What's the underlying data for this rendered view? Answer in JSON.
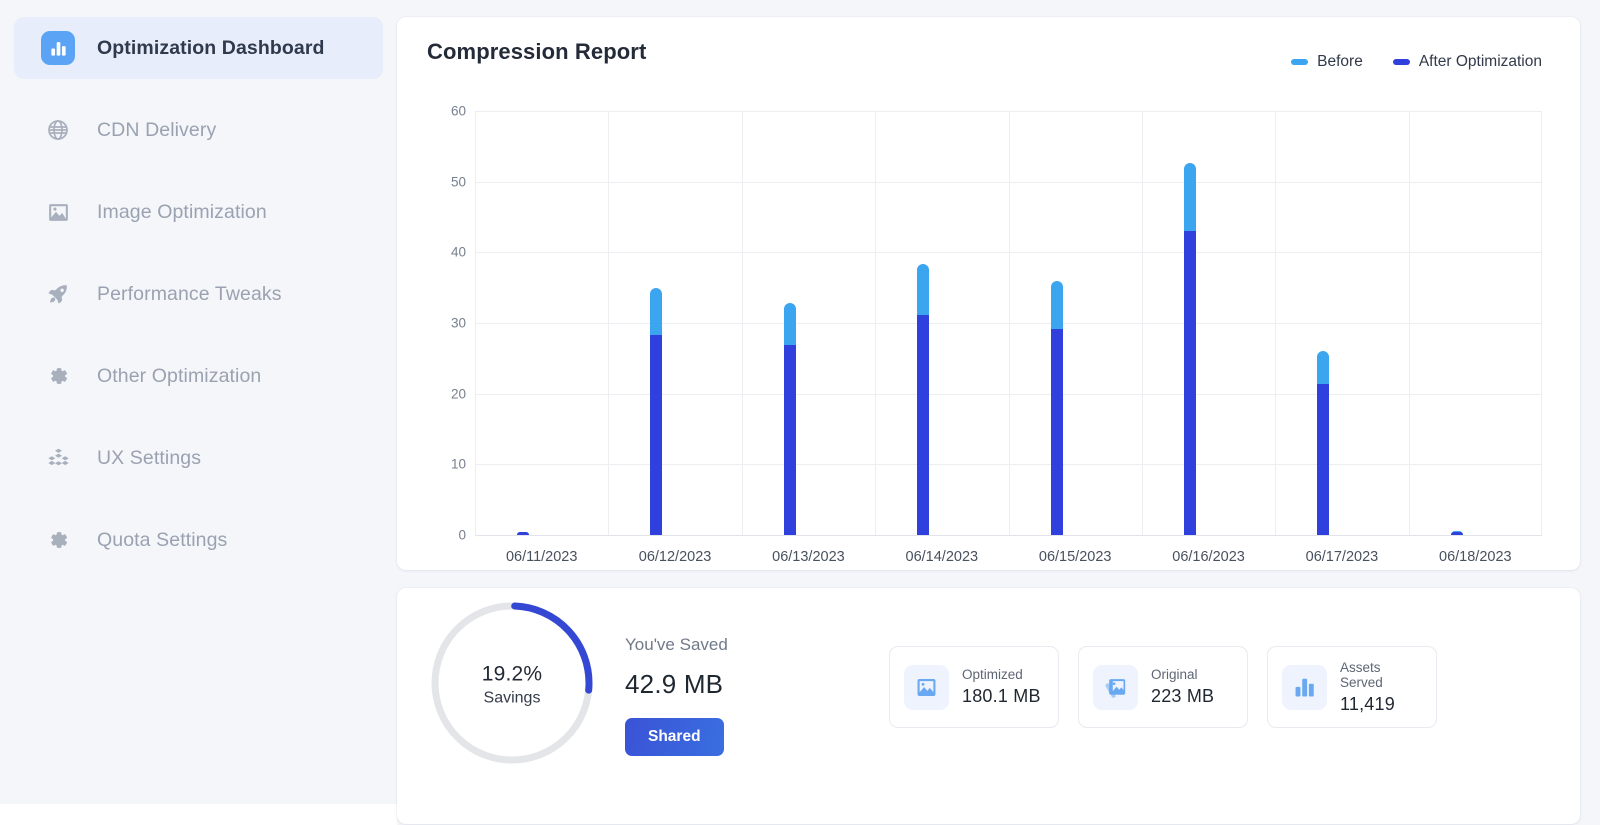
{
  "sidebar": {
    "items": [
      {
        "label": "Optimization Dashboard",
        "icon": "bar-chart-icon",
        "active": true
      },
      {
        "label": "CDN Delivery",
        "icon": "globe-icon",
        "active": false
      },
      {
        "label": "Image Optimization",
        "icon": "image-icon",
        "active": false
      },
      {
        "label": "Performance Tweaks",
        "icon": "rocket-icon",
        "active": false
      },
      {
        "label": "Other Optimization",
        "icon": "gear-icon",
        "active": false
      },
      {
        "label": "UX Settings",
        "icon": "cubes-icon",
        "active": false
      },
      {
        "label": "Quota Settings",
        "icon": "gear-icon",
        "active": false
      }
    ]
  },
  "chart_card": {
    "title": "Compression Report"
  },
  "chart_data": {
    "type": "bar",
    "title": "Compression Report",
    "stacked": true,
    "xlabel": "",
    "ylabel": "",
    "ylim": [
      0,
      60
    ],
    "yticks": [
      0,
      10,
      20,
      30,
      40,
      50,
      60
    ],
    "grid": true,
    "legend_position": "top-right",
    "categories": [
      "06/11/2023",
      "06/12/2023",
      "06/13/2023",
      "06/14/2023",
      "06/15/2023",
      "06/16/2023",
      "06/17/2023",
      "06/18/2023"
    ],
    "series": [
      {
        "name": "After Optimization",
        "color": "#3040dc",
        "values": [
          0.3,
          28.3,
          26.9,
          31.2,
          29.2,
          43.0,
          21.3,
          0.4
        ]
      },
      {
        "name": "Before",
        "color": "#3ca5f0",
        "values": [
          0.3,
          35.0,
          32.8,
          38.3,
          36.0,
          52.7,
          26.1,
          0.5
        ]
      }
    ],
    "legend": [
      "Before",
      "After Optimization"
    ]
  },
  "summary": {
    "donut": {
      "percent_label": "19.2%",
      "sub_label": "Savings",
      "percent_value": 19.2,
      "arc_color": "#3448d4",
      "track_color": "#e3e5e9"
    },
    "saved_title": "You've Saved",
    "saved_value": "42.9 MB",
    "share_label": "Shared",
    "stats": [
      {
        "key": "Optimized",
        "value": "180.1 MB",
        "icon": "image-icon"
      },
      {
        "key": "Original",
        "value": "223 MB",
        "icon": "images-stack-icon"
      },
      {
        "key": "Assets Served",
        "value": "11,419",
        "icon": "bar-chart-icon"
      }
    ]
  }
}
